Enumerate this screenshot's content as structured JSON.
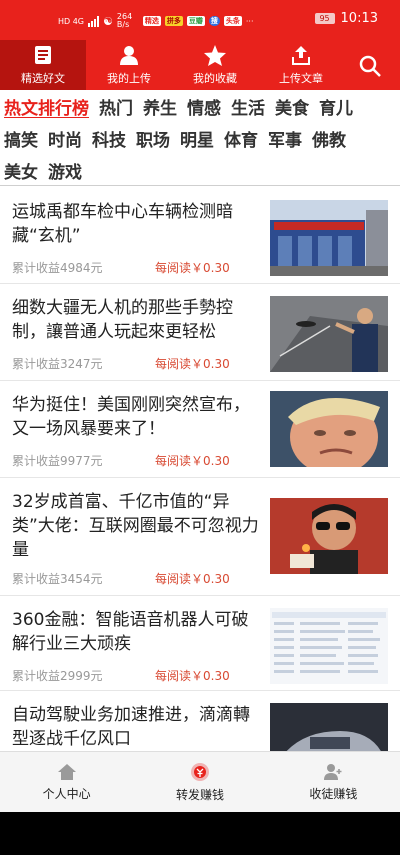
{
  "statusbar": {
    "network": "HD 4G",
    "speed": "264 B/s",
    "app_badges": [
      "精选",
      "拼多",
      "豆瓣",
      "搜",
      "头条"
    ],
    "battery": "95",
    "time": "10:13"
  },
  "topnav": {
    "tabs": [
      {
        "label": "精选好文",
        "icon": "document-icon",
        "active": true
      },
      {
        "label": "我的上传",
        "icon": "user-icon",
        "active": false
      },
      {
        "label": "我的收藏",
        "icon": "star-icon",
        "active": false
      },
      {
        "label": "上传文章",
        "icon": "upload-icon",
        "active": false
      }
    ],
    "search_icon": "search-icon"
  },
  "categories": {
    "rows": [
      [
        "热文排行榜",
        "热门",
        "养生",
        "情感",
        "生活",
        "美食",
        "育儿"
      ],
      [
        "搞笑",
        "时尚",
        "科技",
        "职场",
        "明星",
        "体育",
        "军事",
        "佛教"
      ],
      [
        "美女",
        "游戏"
      ]
    ],
    "active": "热文排行榜"
  },
  "articles": [
    {
      "title": "运城禹都车检中心车辆检测暗藏“玄机”",
      "earnings": "累计收益4984元",
      "price": "每阅读￥0.30",
      "thumb": "building"
    },
    {
      "title": "细数大疆无人机的那些手勢控制，讓普通人玩起來更轻松",
      "earnings": "累计收益3247元",
      "price": "每阅读￥0.30",
      "thumb": "drone"
    },
    {
      "title": "华为挺住！美国刚刚突然宣布，又一场风暴要来了！",
      "earnings": "累计收益9977元",
      "price": "每阅读￥0.30",
      "thumb": "face"
    },
    {
      "title": "32岁成首富、千亿市值的“异类”大佬：互联网圈最不可忽视力量",
      "earnings": "累计收益3454元",
      "price": "每阅读￥0.30",
      "thumb": "movie"
    },
    {
      "title": "360金融：智能语音机器人可破解行业三大顽疾",
      "earnings": "累计收益2999元",
      "price": "每阅读￥0.30",
      "thumb": "table"
    },
    {
      "title": "自动驾駛业务加速推进，滴滴轉型逐战千亿风口",
      "earnings": "",
      "price": "",
      "thumb": "car"
    }
  ],
  "bottombar": {
    "items": [
      {
        "label": "个人中心",
        "icon": "home-icon"
      },
      {
        "label": "转发赚钱",
        "icon": "money-icon"
      },
      {
        "label": "收徒赚钱",
        "icon": "add-user-icon"
      }
    ]
  },
  "colors": {
    "brand": "#e8221c",
    "active_tab": "#b5140f",
    "price": "#d84a33"
  }
}
